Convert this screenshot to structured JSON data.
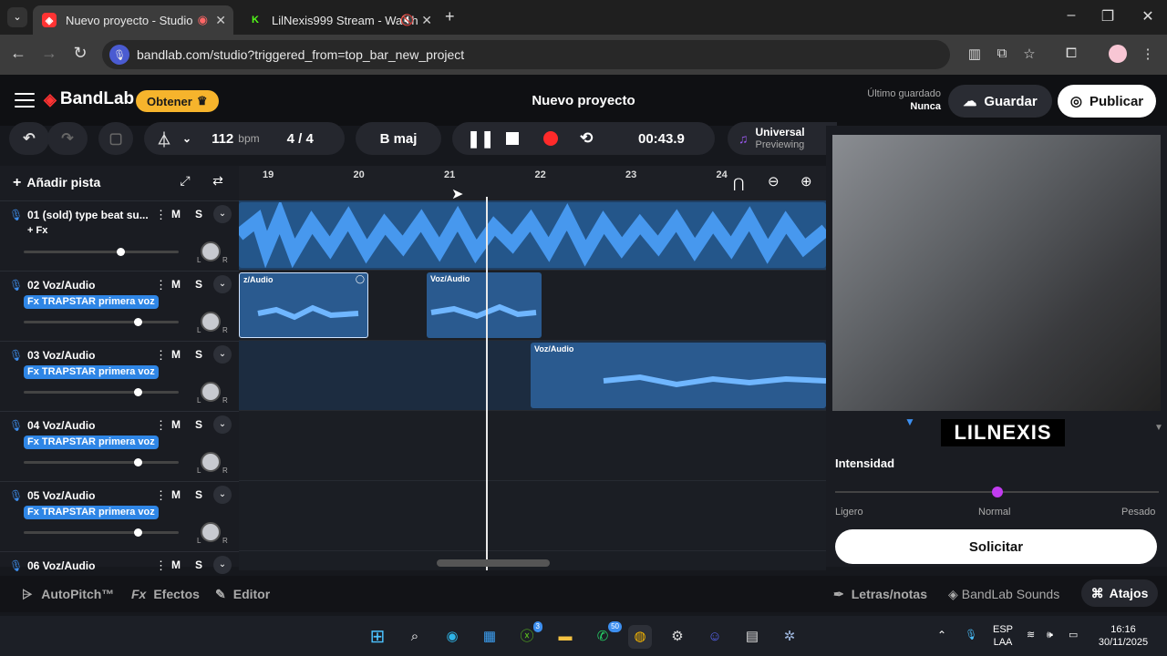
{
  "browser": {
    "tabs": [
      {
        "title": "Nuevo proyecto - Studio",
        "active": true
      },
      {
        "title": "LilNexis999 Stream - Watch",
        "active": false
      }
    ],
    "url": "bandlab.com/studio?triggered_from=top_bar_new_project"
  },
  "header": {
    "brand": "BandLab",
    "obtener": "Obtener",
    "project_title": "Nuevo proyecto",
    "saved_label": "Último guardado",
    "saved_value": "Nunca",
    "guardar": "Guardar",
    "publicar": "Publicar"
  },
  "toolbar": {
    "tempo": "112",
    "tempo_unit": "bpm",
    "time_sig": "4 / 4",
    "key": "B maj",
    "time": "00:43.9",
    "universal_title": "Universal",
    "universal_sub": "Previewing"
  },
  "tracks_panel": {
    "add_track": "Añadir pista",
    "tracks": [
      {
        "name": "01  (sold) type beat su...",
        "fx": "+ Fx",
        "fx_style": "plain",
        "volume": 0.6
      },
      {
        "name": "02  Voz/Audio",
        "fx": "Fx  TRAPSTAR primera voz",
        "fx_style": "chip",
        "volume": 0.71
      },
      {
        "name": "03  Voz/Audio",
        "fx": "Fx  TRAPSTAR primera voz",
        "fx_style": "chip",
        "volume": 0.71
      },
      {
        "name": "04  Voz/Audio",
        "fx": "Fx  TRAPSTAR primera voz",
        "fx_style": "chip",
        "volume": 0.71
      },
      {
        "name": "05  Voz/Audio",
        "fx": "Fx  TRAPSTAR primera voz",
        "fx_style": "chip",
        "volume": 0.71
      },
      {
        "name": "06  Voz/Audio",
        "fx": "",
        "fx_style": "none",
        "volume": 0
      }
    ],
    "mute_label": "M",
    "solo_label": "S",
    "knob_l": "L",
    "knob_r": "R"
  },
  "ruler": {
    "ticks": [
      "19",
      "20",
      "21",
      "22",
      "23",
      "24"
    ]
  },
  "regions": {
    "label": "Voz/Audio",
    "cut_label": "z/Audio"
  },
  "bottom": {
    "autopitch": "AutoPitch™",
    "efectos": "Efectos",
    "editor": "Editor",
    "letras": "Letras/notas",
    "sounds": "BandLab Sounds",
    "atajos": "Atajos"
  },
  "right_panel": {
    "streamer": "LILNEXIS",
    "intensity_title": "Intensidad",
    "intensity_value": 0.5,
    "low": "Ligero",
    "mid": "Normal",
    "high": "Pesado",
    "request": "Solicitar"
  },
  "taskbar": {
    "lang1": "ESP",
    "lang2": "LAA",
    "time": "16:16",
    "date": "30/11/2025",
    "xbox_badge": "3",
    "whatsapp_badge": "50"
  },
  "colors": {
    "accent": "#f6b42c",
    "track_blue": "#2f86e6",
    "record": "#ff2a2a",
    "slider": "#c23cf0"
  }
}
